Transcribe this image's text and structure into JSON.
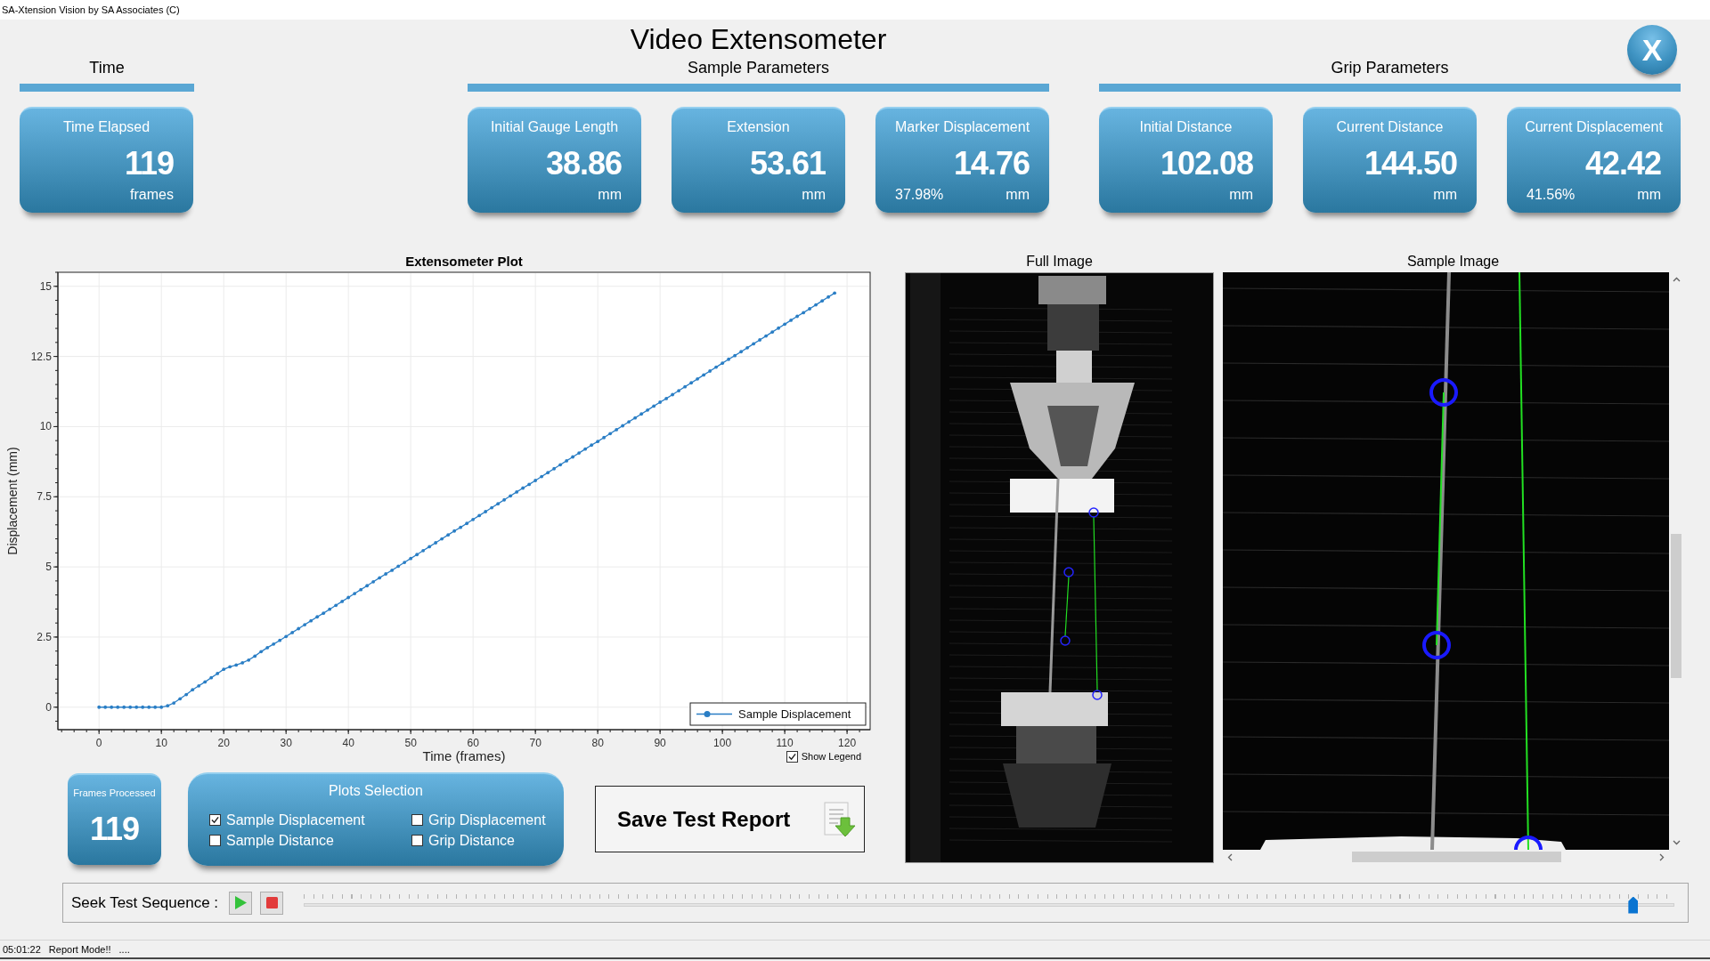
{
  "window": {
    "title": "SA-Xtension Vision by SA Associates (C)"
  },
  "header": {
    "title": "Video Extensometer",
    "close_button": "X"
  },
  "groups": [
    {
      "title": "Time",
      "cards": [
        {
          "label": "Time Elapsed",
          "value": "119",
          "unit": "frames"
        }
      ]
    },
    {
      "title": "Sample Parameters",
      "cards": [
        {
          "label": "Initial Gauge Length",
          "value": "38.86",
          "unit": "mm"
        },
        {
          "label": "Extension",
          "value": "53.61",
          "unit": "mm"
        },
        {
          "label": "Marker Displacement",
          "value": "14.76",
          "unit": "mm",
          "percent": "37.98%"
        }
      ]
    },
    {
      "title": "Grip Parameters",
      "cards": [
        {
          "label": "Initial Distance",
          "value": "102.08",
          "unit": "mm"
        },
        {
          "label": "Current Distance",
          "value": "144.50",
          "unit": "mm"
        },
        {
          "label": "Current Displacement",
          "value": "42.42",
          "unit": "mm",
          "percent": "41.56%"
        }
      ]
    }
  ],
  "plot": {
    "chart_data": {
      "type": "line",
      "title": "Extensometer Plot",
      "xlabel": "Time (frames)",
      "ylabel": "Displacement (mm)",
      "x": [
        0,
        1,
        2,
        3,
        4,
        5,
        6,
        7,
        8,
        9,
        10,
        11,
        12,
        13,
        14,
        15,
        16,
        17,
        18,
        19,
        20,
        21,
        22,
        23,
        24,
        25,
        26,
        27,
        28,
        29,
        30,
        31,
        32,
        33,
        34,
        35,
        36,
        37,
        38,
        39,
        40,
        41,
        42,
        43,
        44,
        45,
        46,
        47,
        48,
        49,
        50,
        51,
        52,
        53,
        54,
        55,
        56,
        57,
        58,
        59,
        60,
        61,
        62,
        63,
        64,
        65,
        66,
        67,
        68,
        69,
        70,
        71,
        72,
        73,
        74,
        75,
        76,
        77,
        78,
        79,
        80,
        81,
        82,
        83,
        84,
        85,
        86,
        87,
        88,
        89,
        90,
        91,
        92,
        93,
        94,
        95,
        96,
        97,
        98,
        99,
        100,
        101,
        102,
        103,
        104,
        105,
        106,
        107,
        108,
        109,
        110,
        111,
        112,
        113,
        114,
        115,
        116,
        117,
        118
      ],
      "series": [
        {
          "name": "Sample Displacement",
          "color": "#2a7ec5",
          "values": [
            0,
            0,
            0,
            0,
            0,
            0,
            0,
            0,
            0,
            0,
            0,
            0.05,
            0.15,
            0.3,
            0.45,
            0.62,
            0.76,
            0.9,
            1.05,
            1.2,
            1.35,
            1.44,
            1.5,
            1.58,
            1.68,
            1.82,
            1.98,
            2.12,
            2.25,
            2.38,
            2.52,
            2.66,
            2.8,
            2.94,
            3.08,
            3.22,
            3.35,
            3.49,
            3.63,
            3.77,
            3.91,
            4.05,
            4.19,
            4.33,
            4.47,
            4.61,
            4.75,
            4.88,
            5.02,
            5.16,
            5.3,
            5.44,
            5.58,
            5.72,
            5.86,
            6,
            6.14,
            6.28,
            6.41,
            6.55,
            6.69,
            6.83,
            6.97,
            7.11,
            7.25,
            7.39,
            7.53,
            7.67,
            7.81,
            7.94,
            8.08,
            8.22,
            8.36,
            8.5,
            8.64,
            8.78,
            8.92,
            9.06,
            9.2,
            9.34,
            9.47,
            9.61,
            9.75,
            9.89,
            10.03,
            10.17,
            10.31,
            10.45,
            10.59,
            10.73,
            10.87,
            11,
            11.14,
            11.28,
            11.42,
            11.56,
            11.7,
            11.84,
            11.98,
            12.12,
            12.26,
            12.4,
            12.53,
            12.67,
            12.81,
            12.95,
            13.09,
            13.23,
            13.37,
            13.51,
            13.65,
            13.79,
            13.93,
            14.06,
            14.2,
            14.34,
            14.48,
            14.62,
            14.76
          ]
        }
      ],
      "xlim": [
        -6.6,
        123.7
      ],
      "ylim": [
        -0.8,
        15.5
      ],
      "xticks": [
        0,
        10,
        20,
        30,
        40,
        50,
        60,
        70,
        80,
        90,
        100,
        110,
        120
      ],
      "yticks": [
        0,
        2.5,
        5,
        7.5,
        10,
        12.5,
        15
      ],
      "grid": true
    },
    "show_legend": {
      "label": "Show Legend",
      "checked": true
    }
  },
  "images": [
    {
      "title": "Full Image",
      "kind": "full_view"
    },
    {
      "title": "Sample Image",
      "kind": "zoom_view"
    }
  ],
  "frames_processed": {
    "label": "Frames Processed",
    "value": "119"
  },
  "plots_selection": {
    "title": "Plots Selection",
    "options": [
      {
        "label": "Sample Displacement",
        "checked": true
      },
      {
        "label": "Grip Displacement",
        "checked": false
      },
      {
        "label": "Sample Distance",
        "checked": false
      },
      {
        "label": "Grip Distance",
        "checked": false
      }
    ]
  },
  "save_button": {
    "label": "Save Test Report"
  },
  "seek": {
    "label": "Seek Test Sequence :",
    "level": 0.97
  },
  "status_bar": [
    "05:01:22",
    "Report Mode!!",
    "...."
  ]
}
